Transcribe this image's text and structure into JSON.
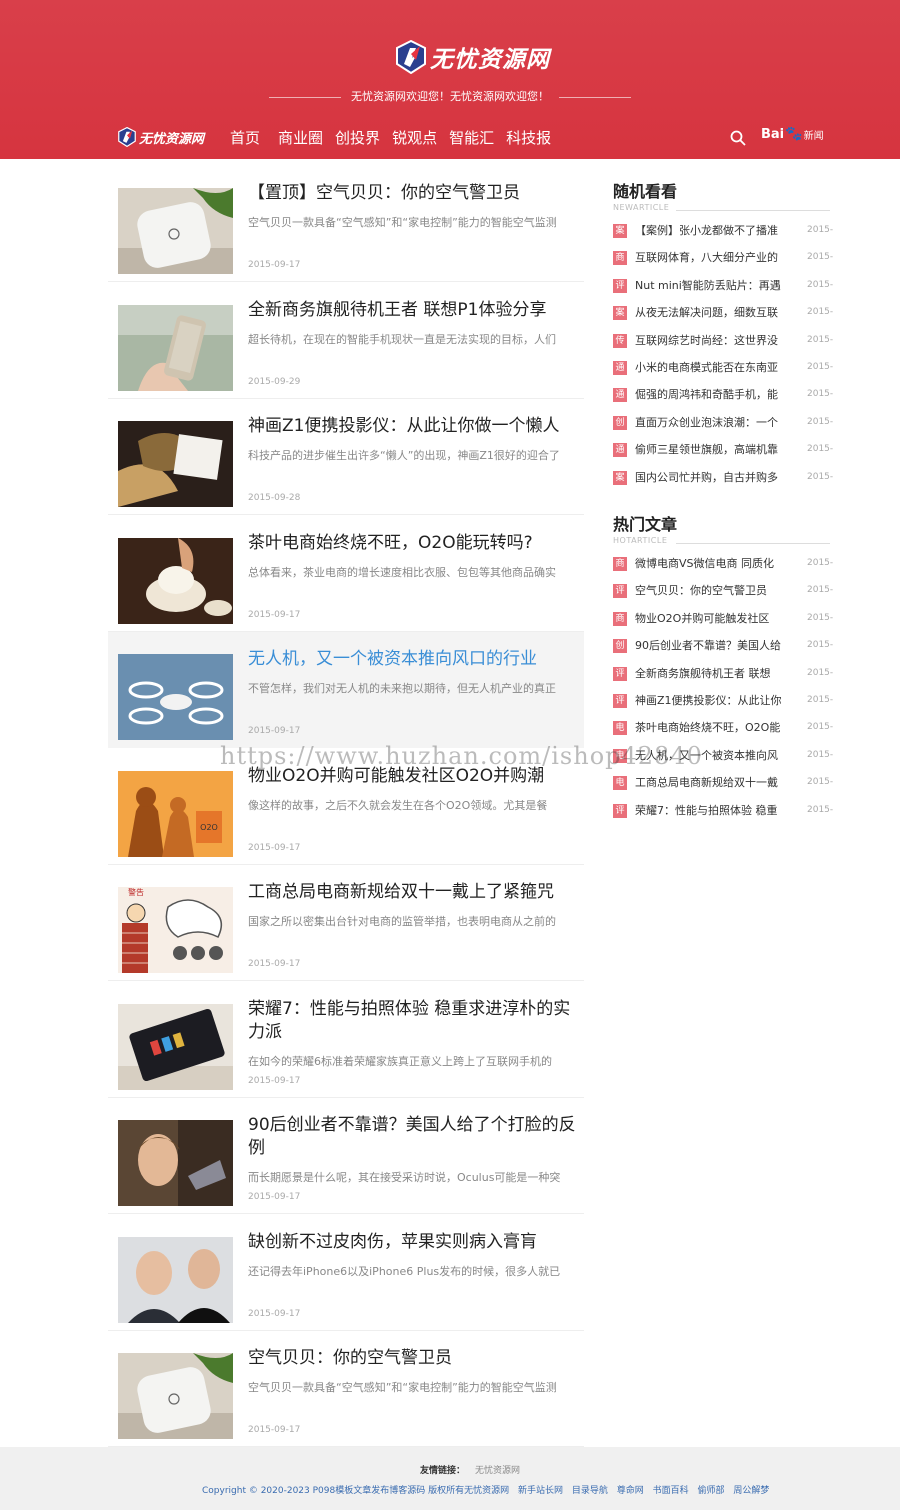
{
  "header": {
    "logo_text": "无忧资源网",
    "welcome": "无忧资源网欢迎您！无忧资源网欢迎您！",
    "nav": [
      "首页",
      "商业圈",
      "创投界",
      "锐观点",
      "智能汇",
      "科技报"
    ],
    "baidu_brand": "Bai",
    "baidu_paw": "🐾",
    "baidu_news": "新闻"
  },
  "articles": [
    {
      "title": "【置顶】空气贝贝：你的空气警卫员",
      "desc": "空气贝贝一款具备“空气感知”和“家电控制”能力的智能空气监测",
      "date": "2015-09-17",
      "image": "air-purifier-photo"
    },
    {
      "title": "全新商务旗舰待机王者 联想P1体验分享",
      "desc": "超长待机，在现在的智能手机现状一直是无法实现的目标，人们",
      "date": "2015-09-29",
      "image": "phone-in-hand-photo"
    },
    {
      "title": "神画Z1便携投影仪：从此让你做一个懒人",
      "desc": "科技产品的进步催生出许多“懒人”的出现，神画Z1很好的迎合了",
      "date": "2015-09-28",
      "image": "projector-photo"
    },
    {
      "title": "茶叶电商始终烧不旺，O2O能玩转吗?",
      "desc": "总体看来，茶业电商的增长速度相比衣服、包包等其他商品确实",
      "date": "2015-09-17",
      "image": "tea-photo"
    },
    {
      "title": "无人机，又一个被资本推向风口的行业",
      "desc": "不管怎样，我们对无人机的未来抱以期待，但无人机产业的真正",
      "date": "2015-09-17",
      "image": "drone-photo"
    },
    {
      "title": "物业O2O并购可能触发社区O2O并购潮",
      "desc": "像这样的故事，之后不久就会发生在各个O2O领域。尤其是餐",
      "date": "2015-09-17",
      "image": "o2o-illustration",
      "badge": "O2O"
    },
    {
      "title": "工商总局电商新规给双十一戴上了紧箍咒",
      "desc": "国家之所以密集出台针对电商的监管举措，也表明电商从之前的",
      "date": "2015-09-17",
      "image": "cartoon-illustration",
      "badge": "警告"
    },
    {
      "title": "荣耀7：性能与拍照体验 稳重求进淳朴的实力派",
      "desc": "在如今的荣耀6标准着荣耀家族真正意义上跨上了互联网手机的",
      "date": "2015-09-17",
      "image": "honor-phone-photo"
    },
    {
      "title": "90后创业者不靠谱？美国人给了个打脸的反例",
      "desc": "而长期愿景是什么呢，其在接受采访时说，Oculus可能是一种突",
      "date": "2015-09-17",
      "image": "founder-photo"
    },
    {
      "title": "缺创新不过皮肉伤，苹果实则病入膏肓",
      "desc": "还记得去年iPhone6以及iPhone6 Plus发布的时候，很多人就已",
      "date": "2015-09-17",
      "image": "apple-ceos-photo"
    },
    {
      "title": "空气贝贝：你的空气警卫员",
      "desc": "空气贝贝一款具备“空气感知”和“家电控制”能力的智能空气监测",
      "date": "2015-09-17",
      "image": "air-purifier-photo"
    }
  ],
  "sidebar": {
    "random": {
      "title": "随机看看",
      "subtitle": "NEWARTICLE",
      "items": [
        {
          "tag": "案",
          "title": "【案例】张小龙都做不了播准",
          "date": "2015-"
        },
        {
          "tag": "商",
          "title": "互联网体育，八大细分产业的",
          "date": "2015-"
        },
        {
          "tag": "评",
          "title": "Nut mini智能防丢贴片：再遇",
          "date": "2015-"
        },
        {
          "tag": "案",
          "title": "从夜无法解决问题，细数互联",
          "date": "2015-"
        },
        {
          "tag": "传",
          "title": "互联网综艺时尚经：这世界没",
          "date": "2015-"
        },
        {
          "tag": "通",
          "title": "小米的电商模式能否在东南亚",
          "date": "2015-"
        },
        {
          "tag": "通",
          "title": "倔强的周鸿祎和奇酷手机，能",
          "date": "2015-"
        },
        {
          "tag": "创",
          "title": "直面万众创业泡沫浪潮：一个",
          "date": "2015-"
        },
        {
          "tag": "通",
          "title": "偷师三星领世旗舰，高端机靠",
          "date": "2015-"
        },
        {
          "tag": "案",
          "title": "国内公司忙并购，自古并购多",
          "date": "2015-"
        }
      ]
    },
    "hot": {
      "title": "热门文章",
      "subtitle": "HOTARTICLE",
      "items": [
        {
          "tag": "商",
          "title": "微博电商VS微信电商 同质化",
          "date": "2015-"
        },
        {
          "tag": "评",
          "title": "空气贝贝：你的空气警卫员",
          "date": "2015-"
        },
        {
          "tag": "商",
          "title": "物业O2O并购可能触发社区",
          "date": "2015-"
        },
        {
          "tag": "创",
          "title": "90后创业者不靠谱？美国人给",
          "date": "2015-"
        },
        {
          "tag": "评",
          "title": "全新商务旗舰待机王者 联想",
          "date": "2015-"
        },
        {
          "tag": "评",
          "title": "神画Z1便携投影仪：从此让你",
          "date": "2015-"
        },
        {
          "tag": "电",
          "title": "茶叶电商始终烧不旺，O2O能",
          "date": "2015-"
        },
        {
          "tag": "电",
          "title": "无人机，又一个被资本推向风",
          "date": "2015-"
        },
        {
          "tag": "电",
          "title": "工商总局电商新规给双十一戴",
          "date": "2015-"
        },
        {
          "tag": "评",
          "title": "荣耀7：性能与拍照体验 稳重",
          "date": "2015-"
        }
      ]
    }
  },
  "footer": {
    "friend_label": "友情链接：",
    "friend_link": "无忧资源网",
    "copyright": "Copyright © 2020-2023 P098模板文章发布博客源码 版权所有无忧资源网",
    "links": [
      "新手站长网",
      "目录导航",
      "尊命网",
      "书面百科",
      "偷师部",
      "周公解梦"
    ]
  },
  "watermark": "https://www.huzhan.com/ishop42840",
  "colors": {
    "header_red": "#d6343f",
    "tag_pink": "#e96f7a",
    "link_blue": "#3a8ed6"
  }
}
